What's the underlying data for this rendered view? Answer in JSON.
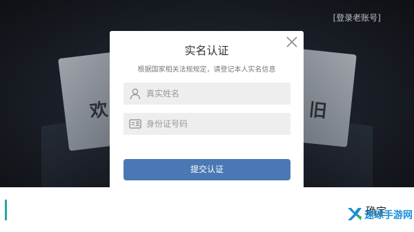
{
  "header": {
    "old_account_link": "[登录老账号]"
  },
  "modal": {
    "title": "实名认证",
    "description": "根据国家相关法规规定，请登记本人实名信息",
    "name_field": {
      "placeholder": "真实姓名",
      "value": ""
    },
    "id_field": {
      "placeholder": "身份证号码",
      "value": ""
    },
    "submit_label": "提交认证"
  },
  "background": {
    "paper_left_text": "欢",
    "paper_right_text": "旧"
  },
  "bottom": {
    "confirm_text": "确定"
  },
  "watermark": {
    "text": "速球手游网"
  },
  "icons": {
    "close": "close-icon",
    "person": "person-icon",
    "id_card": "id-card-icon",
    "logo": "logo-mark-icon"
  },
  "colors": {
    "submit": "#4a78b4",
    "accent": "#1fa8a0",
    "field_bg": "#eeeeee"
  }
}
